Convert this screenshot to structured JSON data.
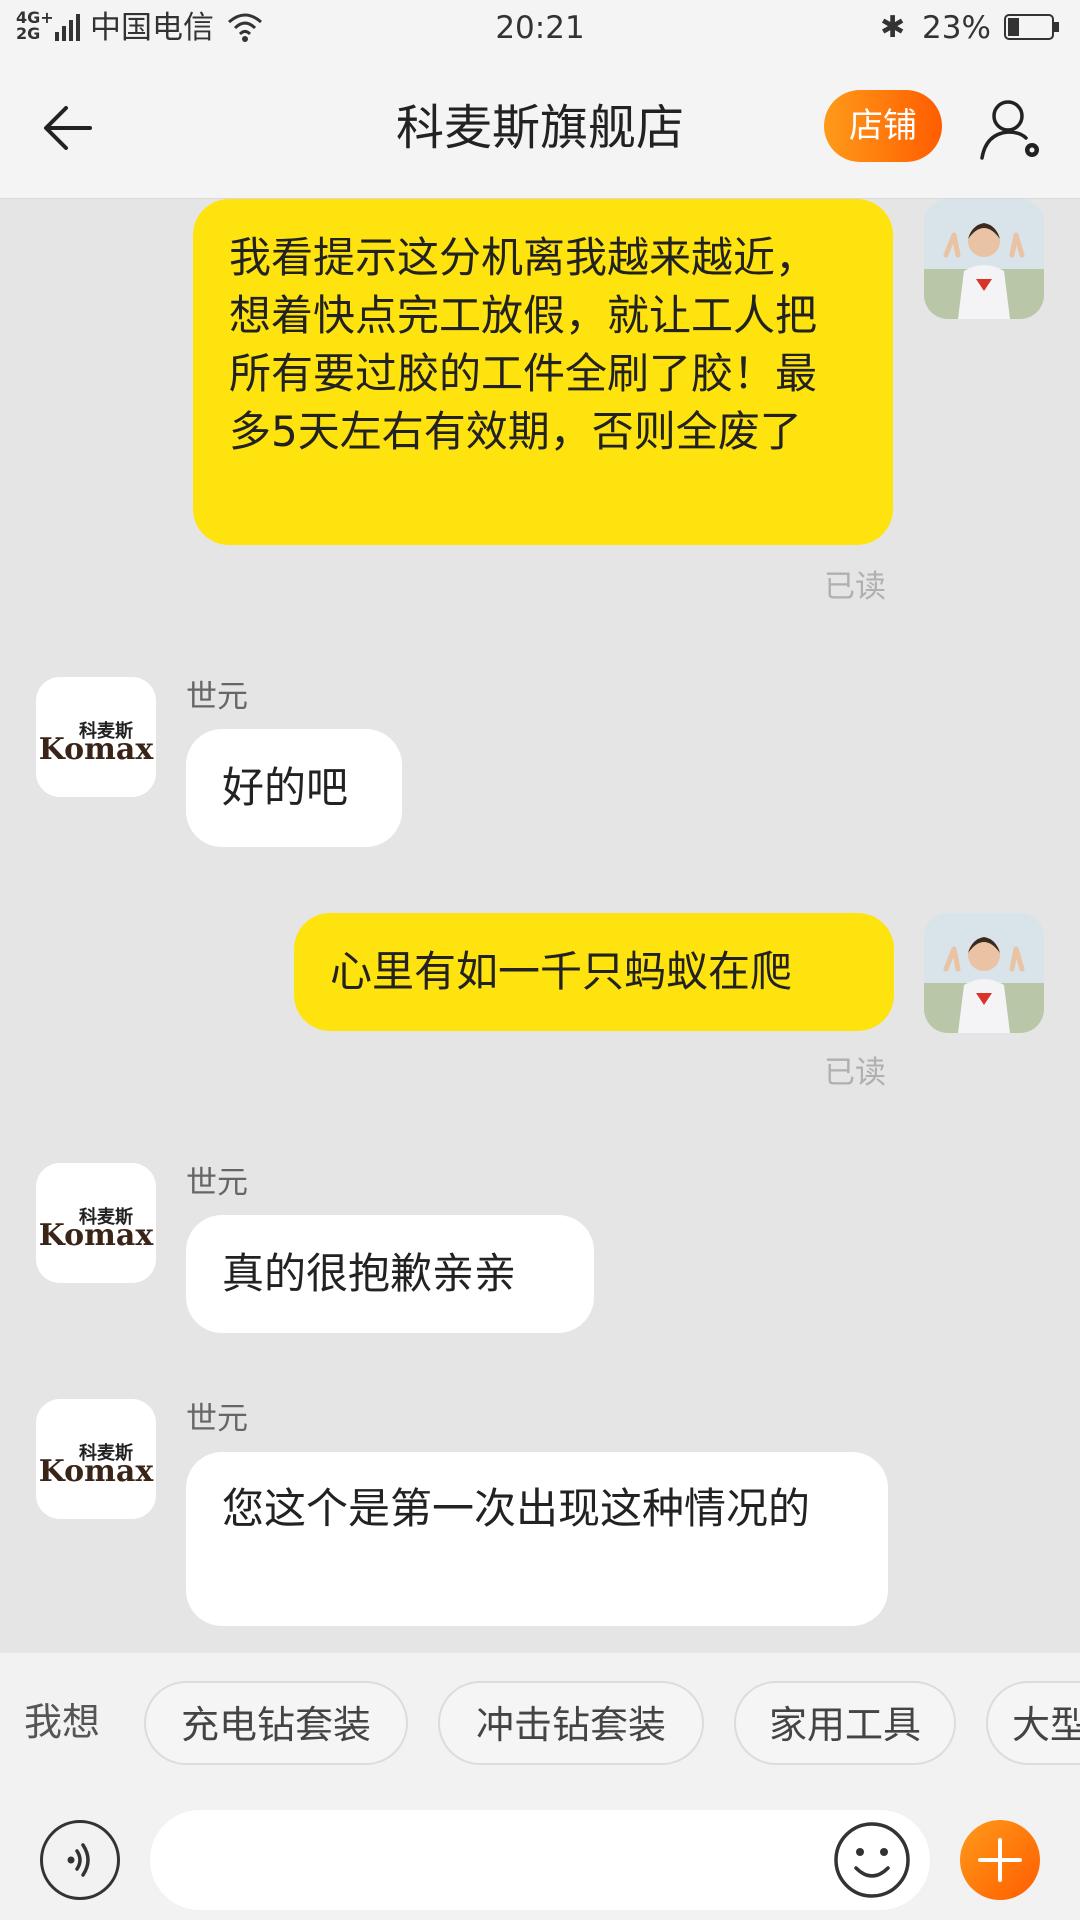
{
  "status_bar": {
    "network": "4G+ 2G",
    "carrier": "中国电信",
    "time": "20:21",
    "battery": "23%",
    "icons": [
      "signal-icon",
      "wifi-icon",
      "bluetooth-icon",
      "battery-icon"
    ]
  },
  "header": {
    "title": "科麦斯旗舰店",
    "shop_button": "店铺",
    "icons": [
      "back-arrow-icon",
      "profile-settings-icon"
    ],
    "accent_color": "#ff6a00"
  },
  "messages": [
    {
      "from": "me",
      "text": "我看提示这分机离我越来越近，想着快点完工放假，就让工人把所有要过胶的工件全刷了胶！最多5天左右有效期，否则全废了",
      "status": "已读"
    },
    {
      "from": "shop",
      "sender": "世元",
      "text": "好的吧"
    },
    {
      "from": "me",
      "text": "心里有如一千只蚂蚁在爬",
      "status": "已读"
    },
    {
      "from": "shop",
      "sender": "世元",
      "text": "真的很抱歉亲亲"
    },
    {
      "from": "shop",
      "sender": "世元",
      "text": "您这个是第一次出现这种情况的"
    }
  ],
  "shop_avatar": {
    "cn": "科麦斯",
    "en": "Komax"
  },
  "suggestions": {
    "label": "我想",
    "chips": [
      "充电钻套装",
      "冲击钻套装",
      "家用工具",
      "大型"
    ]
  },
  "input": {
    "value": "",
    "icons": [
      "voice-icon",
      "emoji-icon",
      "plus-icon"
    ]
  },
  "colors": {
    "my_bubble": "#ffe30f",
    "their_bubble": "#ffffff",
    "chat_background": "#e5e5e5"
  }
}
